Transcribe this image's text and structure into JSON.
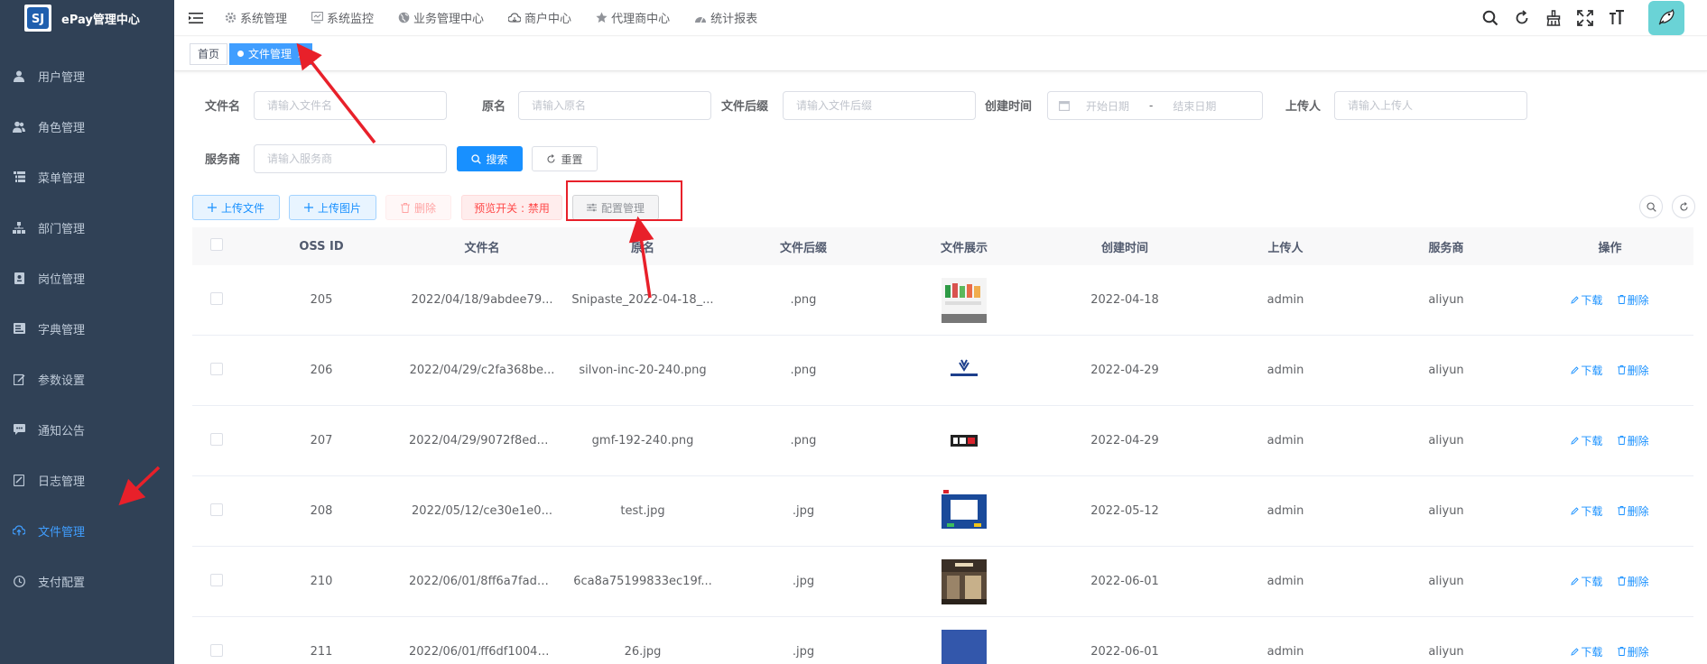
{
  "sidebar": {
    "logo_text": "ePay管理中心",
    "items": [
      {
        "label": "用户管理",
        "icon": "user-icon"
      },
      {
        "label": "角色管理",
        "icon": "peoples-icon"
      },
      {
        "label": "菜单管理",
        "icon": "tree-table-icon"
      },
      {
        "label": "部门管理",
        "icon": "tree-icon"
      },
      {
        "label": "岗位管理",
        "icon": "post-icon"
      },
      {
        "label": "字典管理",
        "icon": "dict-icon"
      },
      {
        "label": "参数设置",
        "icon": "edit-icon"
      },
      {
        "label": "通知公告",
        "icon": "message-icon"
      },
      {
        "label": "日志管理",
        "icon": "log-icon"
      },
      {
        "label": "文件管理",
        "icon": "upload-icon",
        "active": true
      },
      {
        "label": "支付配置",
        "icon": "clock-icon"
      }
    ]
  },
  "topnav": {
    "items": [
      {
        "label": "系统管理",
        "icon": "gear-icon"
      },
      {
        "label": "系统监控",
        "icon": "monitor-icon"
      },
      {
        "label": "业务管理中心",
        "icon": "globe-icon"
      },
      {
        "label": "商户中心",
        "icon": "cloud-icon"
      },
      {
        "label": "代理商中心",
        "icon": "star-icon"
      },
      {
        "label": "统计报表",
        "icon": "dashboard-icon"
      }
    ]
  },
  "tags": {
    "home": "首页",
    "current": "文件管理",
    "close": "×"
  },
  "search": {
    "filename_label": "文件名",
    "filename_placeholder": "请输入文件名",
    "original_label": "原名",
    "original_placeholder": "请输入原名",
    "suffix_label": "文件后缀",
    "suffix_placeholder": "请输入文件后缀",
    "created_label": "创建时间",
    "start_placeholder": "开始日期",
    "range_sep": "-",
    "end_placeholder": "结束日期",
    "uploader_label": "上传人",
    "uploader_placeholder": "请输入上传人",
    "service_label": "服务商",
    "service_placeholder": "请输入服务商",
    "search_btn": "搜索",
    "reset_btn": "重置"
  },
  "toolbar": {
    "upload_file": "上传文件",
    "upload_image": "上传图片",
    "delete": "删除",
    "preview_switch": "预览开关 : 禁用",
    "config": "配置管理"
  },
  "table": {
    "headers": [
      "OSS ID",
      "文件名",
      "原名",
      "文件后缀",
      "文件展示",
      "创建时间",
      "上传人",
      "服务商",
      "操作"
    ],
    "op_download": "下载",
    "op_delete": "删除",
    "rows": [
      {
        "id": "205",
        "name": "2022/04/18/9abdee79...",
        "orig": "Snipaste_2022-04-18_...",
        "suffix": ".png",
        "time": "2022-04-18",
        "uploader": "admin",
        "service": "aliyun"
      },
      {
        "id": "206",
        "name": "2022/04/29/c2fa368be...",
        "orig": "silvon-inc-20-240.png",
        "suffix": ".png",
        "time": "2022-04-29",
        "uploader": "admin",
        "service": "aliyun"
      },
      {
        "id": "207",
        "name": "2022/04/29/9072f8ed1...",
        "orig": "gmf-192-240.png",
        "suffix": ".png",
        "time": "2022-04-29",
        "uploader": "admin",
        "service": "aliyun"
      },
      {
        "id": "208",
        "name": "2022/05/12/ce30e1e0...",
        "orig": "test.jpg",
        "suffix": ".jpg",
        "time": "2022-05-12",
        "uploader": "admin",
        "service": "aliyun"
      },
      {
        "id": "210",
        "name": "2022/06/01/8ff6a7fadd...",
        "orig": "6ca8a75199833ec19f...",
        "suffix": ".jpg",
        "time": "2022-06-01",
        "uploader": "admin",
        "service": "aliyun"
      },
      {
        "id": "211",
        "name": "2022/06/01/ff6df10042...",
        "orig": "26.jpg",
        "suffix": ".jpg",
        "time": "2022-06-01",
        "uploader": "admin",
        "service": "aliyun"
      }
    ]
  },
  "colors": {
    "sidebar_bg": "#304156",
    "primary": "#1890ff",
    "annotation_red": "#e8202a",
    "avatar_bg": "#6ad3d6"
  }
}
